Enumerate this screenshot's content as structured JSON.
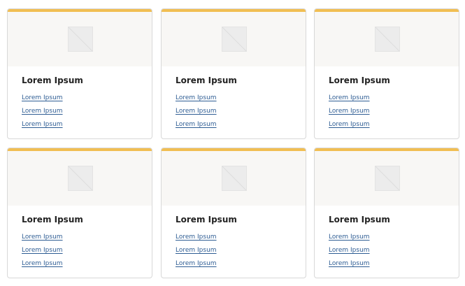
{
  "cards": [
    {
      "title": "Lorem Ipsum",
      "links": [
        "Lorem Ipsum",
        "Lorem Ipsum",
        "Lorem Ipsum"
      ]
    },
    {
      "title": "Lorem Ipsum",
      "links": [
        "Lorem Ipsum",
        "Lorem Ipsum",
        "Lorem Ipsum"
      ]
    },
    {
      "title": "Lorem Ipsum",
      "links": [
        "Lorem Ipsum",
        "Lorem Ipsum",
        "Lorem Ipsum"
      ]
    },
    {
      "title": "Lorem Ipsum",
      "links": [
        "Lorem Ipsum",
        "Lorem Ipsum",
        "Lorem Ipsum"
      ]
    },
    {
      "title": "Lorem Ipsum",
      "links": [
        "Lorem Ipsum",
        "Lorem Ipsum",
        "Lorem Ipsum"
      ]
    },
    {
      "title": "Lorem Ipsum",
      "links": [
        "Lorem Ipsum",
        "Lorem Ipsum",
        "Lorem Ipsum"
      ]
    }
  ],
  "theme": {
    "accent": "#f1be52",
    "link_color": "#2d5c93",
    "title_color": "#222222",
    "border_color": "#d8d8d8",
    "media_bg": "#f8f7f5"
  },
  "icons": {
    "placeholder": "image-placeholder-icon"
  }
}
